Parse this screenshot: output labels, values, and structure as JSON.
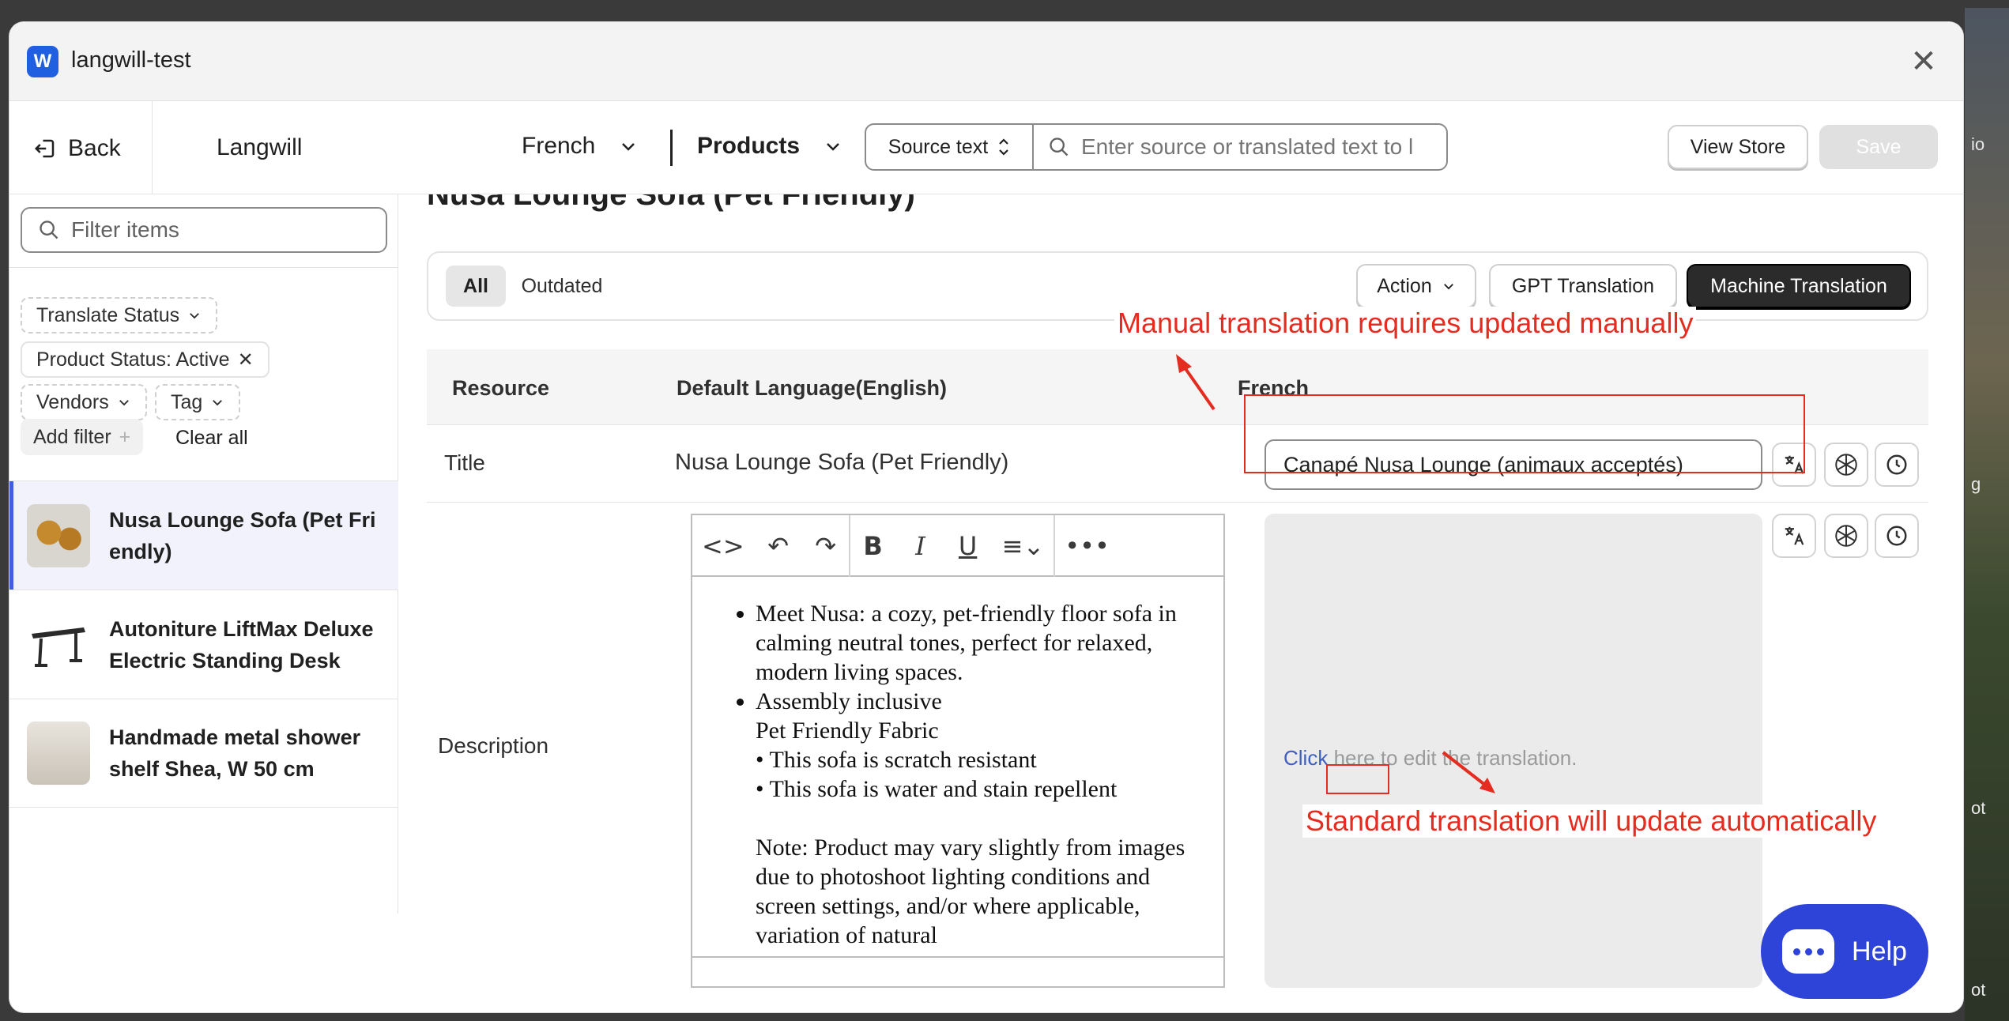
{
  "window": {
    "app_title": "langwill-test",
    "logo_letter": "W"
  },
  "toolbar": {
    "back_label": "Back",
    "brand": "Langwill",
    "language": "French",
    "resource_type": "Products",
    "source_select": "Source text",
    "search_placeholder": "Enter source or translated text to l",
    "view_store_label": "View Store",
    "save_label": "Save"
  },
  "sidebar": {
    "filter_placeholder": "Filter items",
    "filters": {
      "translate_status": "Translate Status",
      "product_status": "Product Status: Active",
      "vendors": "Vendors",
      "tag": "Tag",
      "add_filter": "Add filter",
      "clear_all": "Clear all"
    },
    "items": [
      {
        "label": "Nusa Lounge Sofa (Pet Friendly)",
        "active": true
      },
      {
        "label": "Autoniture LiftMax Deluxe Electric Standing Desk",
        "active": false
      },
      {
        "label": "Handmade metal shower shelf Shea, W 50 cm",
        "active": false
      }
    ]
  },
  "main": {
    "heading": "Nusa Lounge Sofa (Pet Friendly)",
    "tabs": {
      "all": "All",
      "outdated": "Outdated"
    },
    "actions": {
      "action": "Action",
      "gpt": "GPT Translation",
      "machine": "Machine Translation"
    },
    "table": {
      "col_resource": "Resource",
      "col_default": "Default Language(English)",
      "col_target": "French",
      "title_row": {
        "label": "Title",
        "default": "Nusa Lounge Sofa (Pet Friendly)",
        "target": "Canapé Nusa Lounge (animaux acceptés)"
      },
      "description_row": {
        "label": "Description",
        "bullets": [
          "Meet Nusa: a cozy, pet-friendly floor sofa in calming neutral tones, perfect for relaxed, modern living spaces.",
          "Assembly inclusive"
        ],
        "lines": [
          "Pet Friendly Fabric",
          "• This sofa is scratch resistant",
          "• This sofa is water and stain repellent"
        ],
        "note": "Note: Product may vary slightly from images due to photoshoot lighting conditions and screen settings, and/or where applicable, variation of natural",
        "target_placeholder_link": "Click",
        "target_placeholder_rest": " here to edit the translation."
      }
    }
  },
  "annotations": {
    "manual": "Manual translation requires updated manually",
    "standard": "Standard translation will update automatically"
  },
  "help": {
    "label": "Help"
  },
  "colors": {
    "accent": "#2e43d8",
    "annotation": "#e52c20",
    "active_item": "#3f5fe0"
  },
  "icons": [
    "back-icon",
    "chevron-down-icon",
    "search-icon",
    "close-icon",
    "translate-icon",
    "openai-icon",
    "history-icon",
    "code-icon",
    "undo-icon",
    "redo-icon",
    "bold-icon",
    "italic-icon",
    "underline-icon",
    "align-icon",
    "more-icon",
    "chat-icon"
  ]
}
